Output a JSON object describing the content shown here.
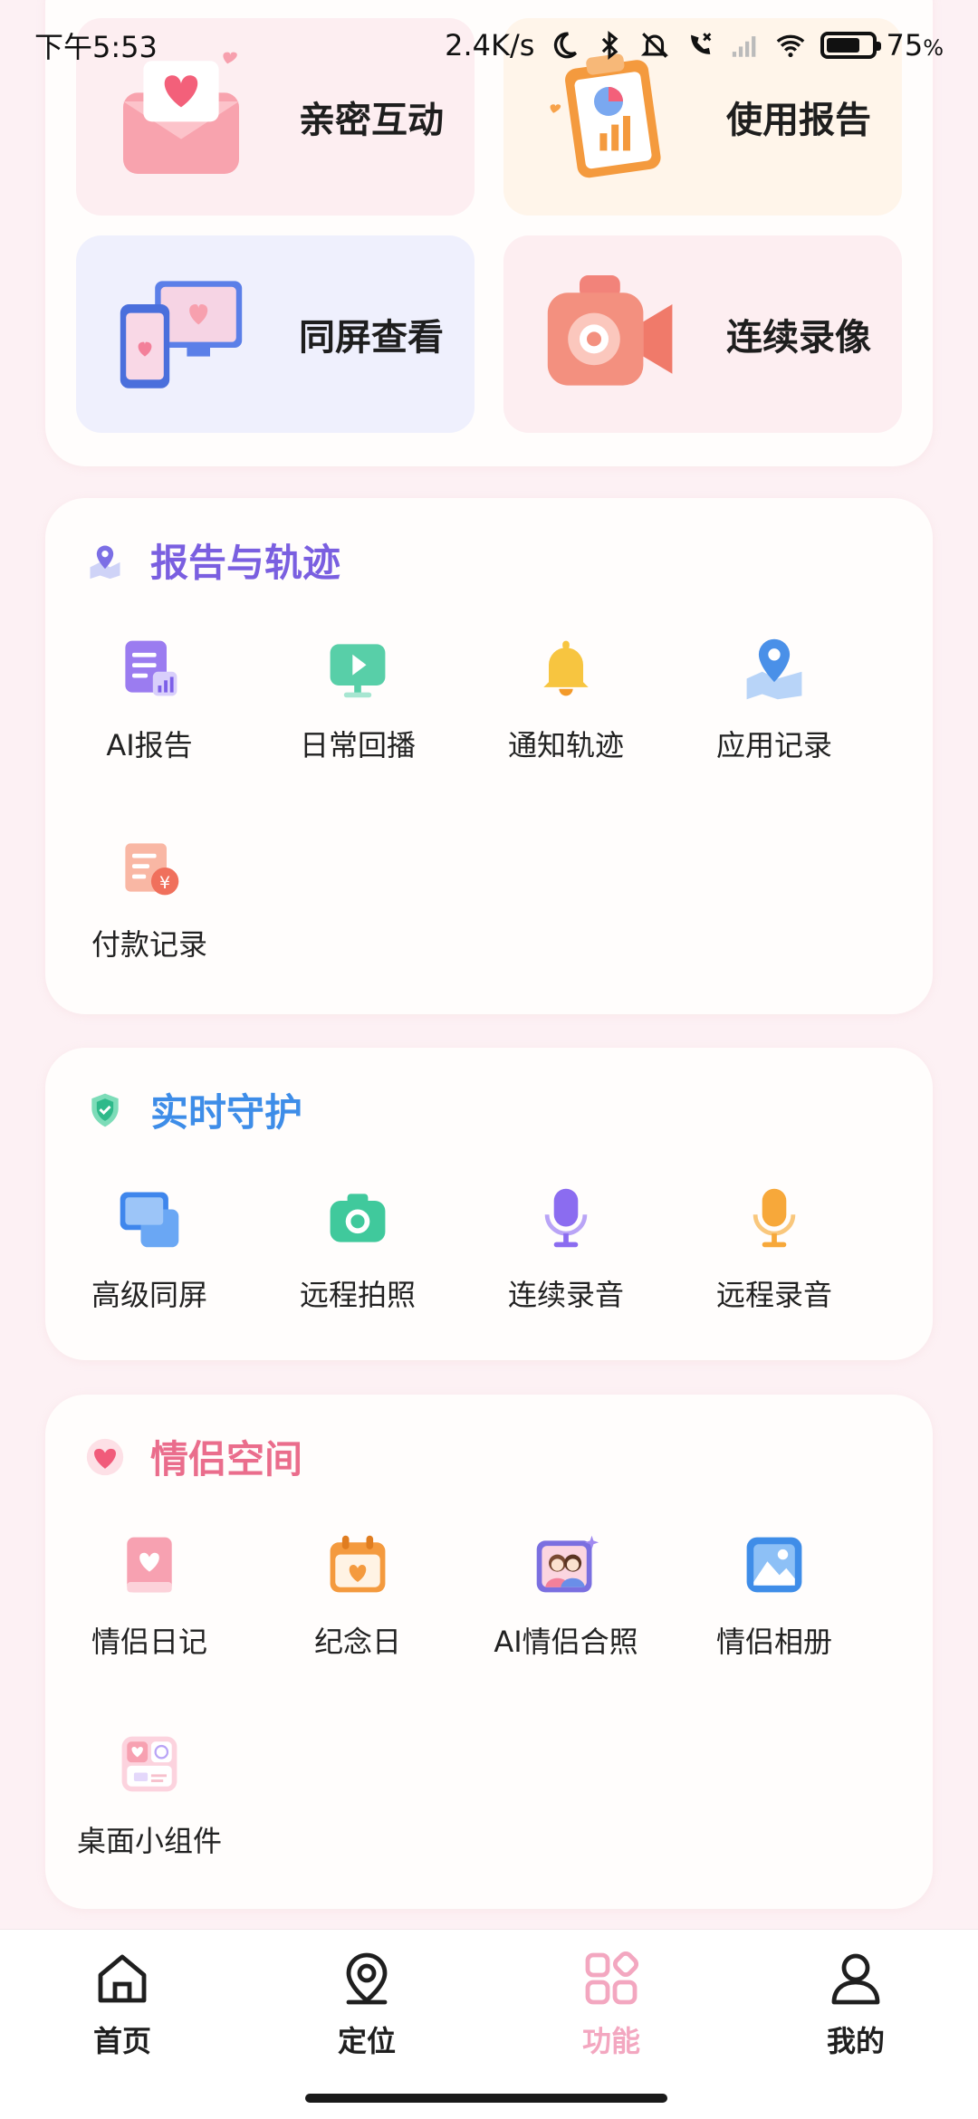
{
  "status_bar": {
    "time": "下午5:53",
    "speed": "2.4K/s",
    "battery": "75",
    "battery_unit": "%",
    "battery_level": 0.75
  },
  "top_features": [
    {
      "label": "亲密互动",
      "bg": "#fdeef1"
    },
    {
      "label": "使用报告",
      "bg": "#fff5ea"
    },
    {
      "label": "同屏查看",
      "bg": "#eff0fd"
    },
    {
      "label": "连续录像",
      "bg": "#fdeef1"
    }
  ],
  "sections": {
    "report": {
      "title": "报告与轨迹",
      "color": "#7a5fe0",
      "items": [
        {
          "label": "AI报告"
        },
        {
          "label": "日常回播"
        },
        {
          "label": "通知轨迹"
        },
        {
          "label": "应用记录"
        },
        {
          "label": "付款记录"
        }
      ]
    },
    "guard": {
      "title": "实时守护",
      "color": "#3e8de8",
      "items": [
        {
          "label": "高级同屏"
        },
        {
          "label": "远程拍照"
        },
        {
          "label": "连续录音"
        },
        {
          "label": "远程录音"
        }
      ]
    },
    "couple": {
      "title": "情侣空间",
      "color": "#ea6d8c",
      "items": [
        {
          "label": "情侣日记"
        },
        {
          "label": "纪念日"
        },
        {
          "label": "AI情侣合照"
        },
        {
          "label": "情侣相册"
        },
        {
          "label": "桌面小组件"
        }
      ]
    }
  },
  "bottom_nav": [
    {
      "label": "首页",
      "active": false
    },
    {
      "label": "定位",
      "active": false
    },
    {
      "label": "功能",
      "active": true
    },
    {
      "label": "我的",
      "active": false
    }
  ],
  "colors": {
    "accent_pink": "#f3a7c0",
    "page_bg": "#fdf1f4"
  }
}
